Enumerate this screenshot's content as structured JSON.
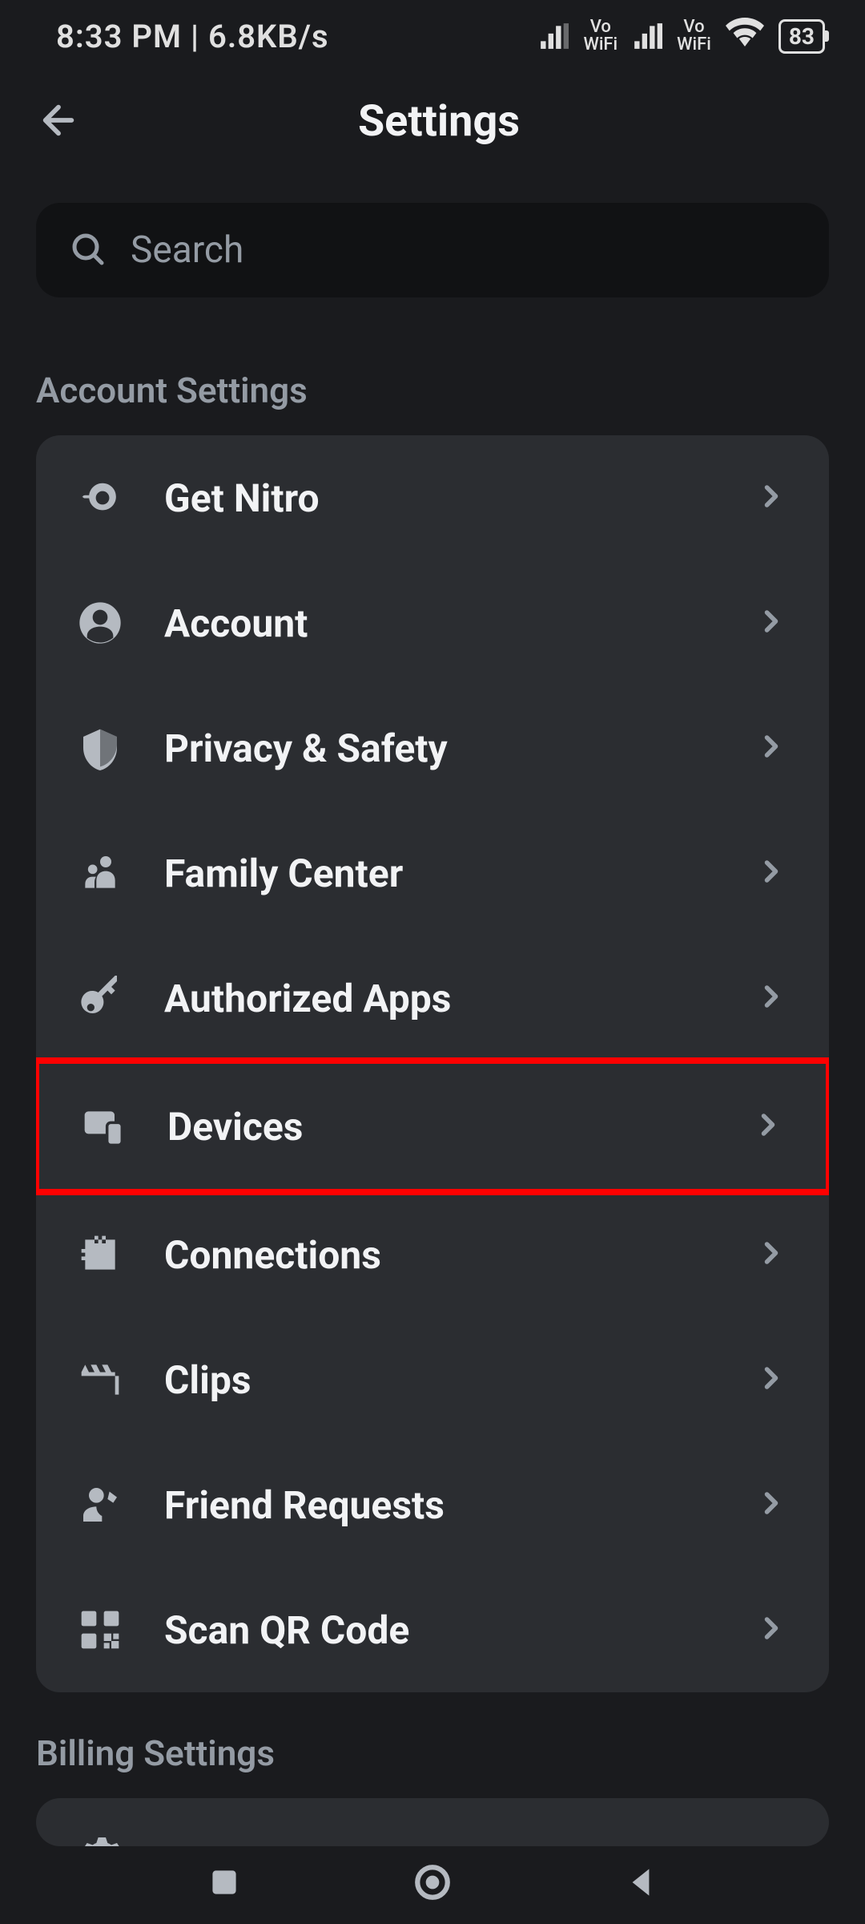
{
  "status_bar": {
    "time": "8:33 PM",
    "data_rate": "6.8KB/s",
    "vo_label1": "Vo",
    "wifi_label1": "WiFi",
    "vo_label2": "Vo",
    "wifi_label2": "WiFi",
    "battery": "83"
  },
  "header": {
    "title": "Settings"
  },
  "search": {
    "placeholder": "Search"
  },
  "sections": {
    "account_header": "Account Settings",
    "billing_header": "Billing Settings"
  },
  "items": [
    {
      "label": "Get Nitro",
      "highlighted": false
    },
    {
      "label": "Account",
      "highlighted": false
    },
    {
      "label": "Privacy & Safety",
      "highlighted": false
    },
    {
      "label": "Family Center",
      "highlighted": false
    },
    {
      "label": "Authorized Apps",
      "highlighted": false
    },
    {
      "label": "Devices",
      "highlighted": true
    },
    {
      "label": "Connections",
      "highlighted": false
    },
    {
      "label": "Clips",
      "highlighted": false
    },
    {
      "label": "Friend Requests",
      "highlighted": false
    },
    {
      "label": "Scan QR Code",
      "highlighted": false
    }
  ]
}
